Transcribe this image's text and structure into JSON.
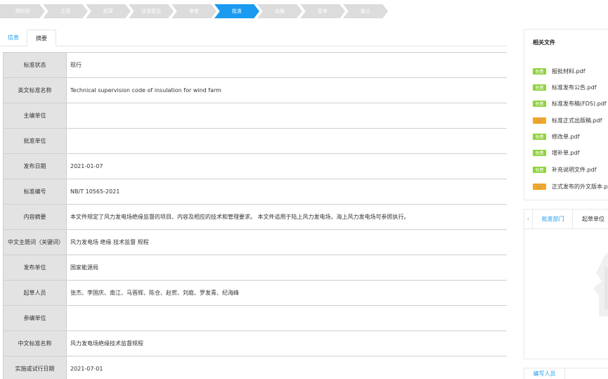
{
  "steps": [
    "预阶段",
    "立项",
    "起草",
    "征求意见",
    "审查",
    "批准",
    "出版",
    "复审",
    "废止"
  ],
  "active_step": "批准",
  "tabs": {
    "info": "信息",
    "summary": "摘要"
  },
  "fields": [
    {
      "label": "标准状态",
      "value": "现行"
    },
    {
      "label": "英文标准名称",
      "value": "Technical supervision code of insulation for wind farm"
    },
    {
      "label": "主编单位",
      "value": ""
    },
    {
      "label": "批准单位",
      "value": ""
    },
    {
      "label": "发布日期",
      "value": "2021-01-07"
    },
    {
      "label": "标准编号",
      "value": "NB/T 10565-2021"
    },
    {
      "label": "内容摘要",
      "value": "本文件规定了风力发电场绝缘监督的项目、内容及相应的技术和管理要求。 本文件适用于陆上风力发电场，海上风力发电场可参照执行。"
    },
    {
      "label": "中文主题词（关键词）",
      "value": "风力发电场 绝缘 技术监督 规程"
    },
    {
      "label": "发布单位",
      "value": "国家能源局"
    },
    {
      "label": "起草人员",
      "value": "张杰、李国庆、南江、马晋辉、陈仓、赵贺、刘庭、罗发青、纪海峰"
    },
    {
      "label": "参编单位",
      "value": ""
    },
    {
      "label": "中文标准名称",
      "value": "风力发电场绝缘技术监督规程"
    },
    {
      "label": "实施或试行日期",
      "value": "2021-07-01"
    }
  ],
  "related_files": {
    "title": "相关文件",
    "items": [
      {
        "badge": "免费",
        "type": "free",
        "name": "报批材料.pdf"
      },
      {
        "badge": "免费",
        "type": "free",
        "name": "标准发布公告.pdf"
      },
      {
        "badge": "免费",
        "type": "free",
        "name": "标准发布稿(FDS).pdf"
      },
      {
        "badge": "🛒",
        "type": "cart",
        "name": "标准正式出版稿.pdf"
      },
      {
        "badge": "免费",
        "type": "free",
        "name": "修改单.pdf"
      },
      {
        "badge": "免费",
        "type": "free",
        "name": "增补单.pdf"
      },
      {
        "badge": "免费",
        "type": "free",
        "name": "补充说明文件.pdf"
      },
      {
        "badge": "🛒",
        "type": "cart",
        "name": "正式发布的外文版本.pdf"
      }
    ]
  },
  "dept_tabs": {
    "arrow": "‹",
    "approval": "批准部门",
    "drafting": "起草单位"
  },
  "writer_tab": "编写人员",
  "colors": {
    "accent": "#1a9bf0",
    "step_inactive": "#dcdcdc",
    "label_bg": "#e3e3e3",
    "free_badge": "#8fd33d",
    "cart_badge": "#f5a623"
  }
}
